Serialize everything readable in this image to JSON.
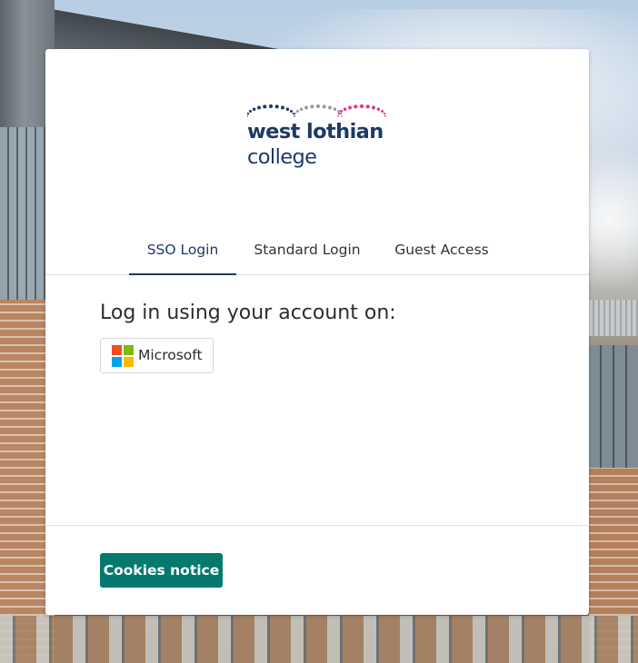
{
  "brand": {
    "name_line1": "west lothian",
    "name_line2": "college",
    "color_navy": "#1d3a67",
    "color_grey_dots": "#9b9b9b",
    "color_pink_dots": "#e0368a",
    "color_navy_dots": "#1d3a67"
  },
  "tabs": [
    {
      "label": "SSO Login",
      "active": true
    },
    {
      "label": "Standard Login",
      "active": false
    },
    {
      "label": "Guest Access",
      "active": false
    }
  ],
  "sso": {
    "heading": "Log in using your account on:",
    "providers": [
      {
        "label": "Microsoft",
        "icon": "microsoft-logo-icon"
      }
    ]
  },
  "footer": {
    "cookies_label": "Cookies notice",
    "accent": "#047a6e"
  }
}
